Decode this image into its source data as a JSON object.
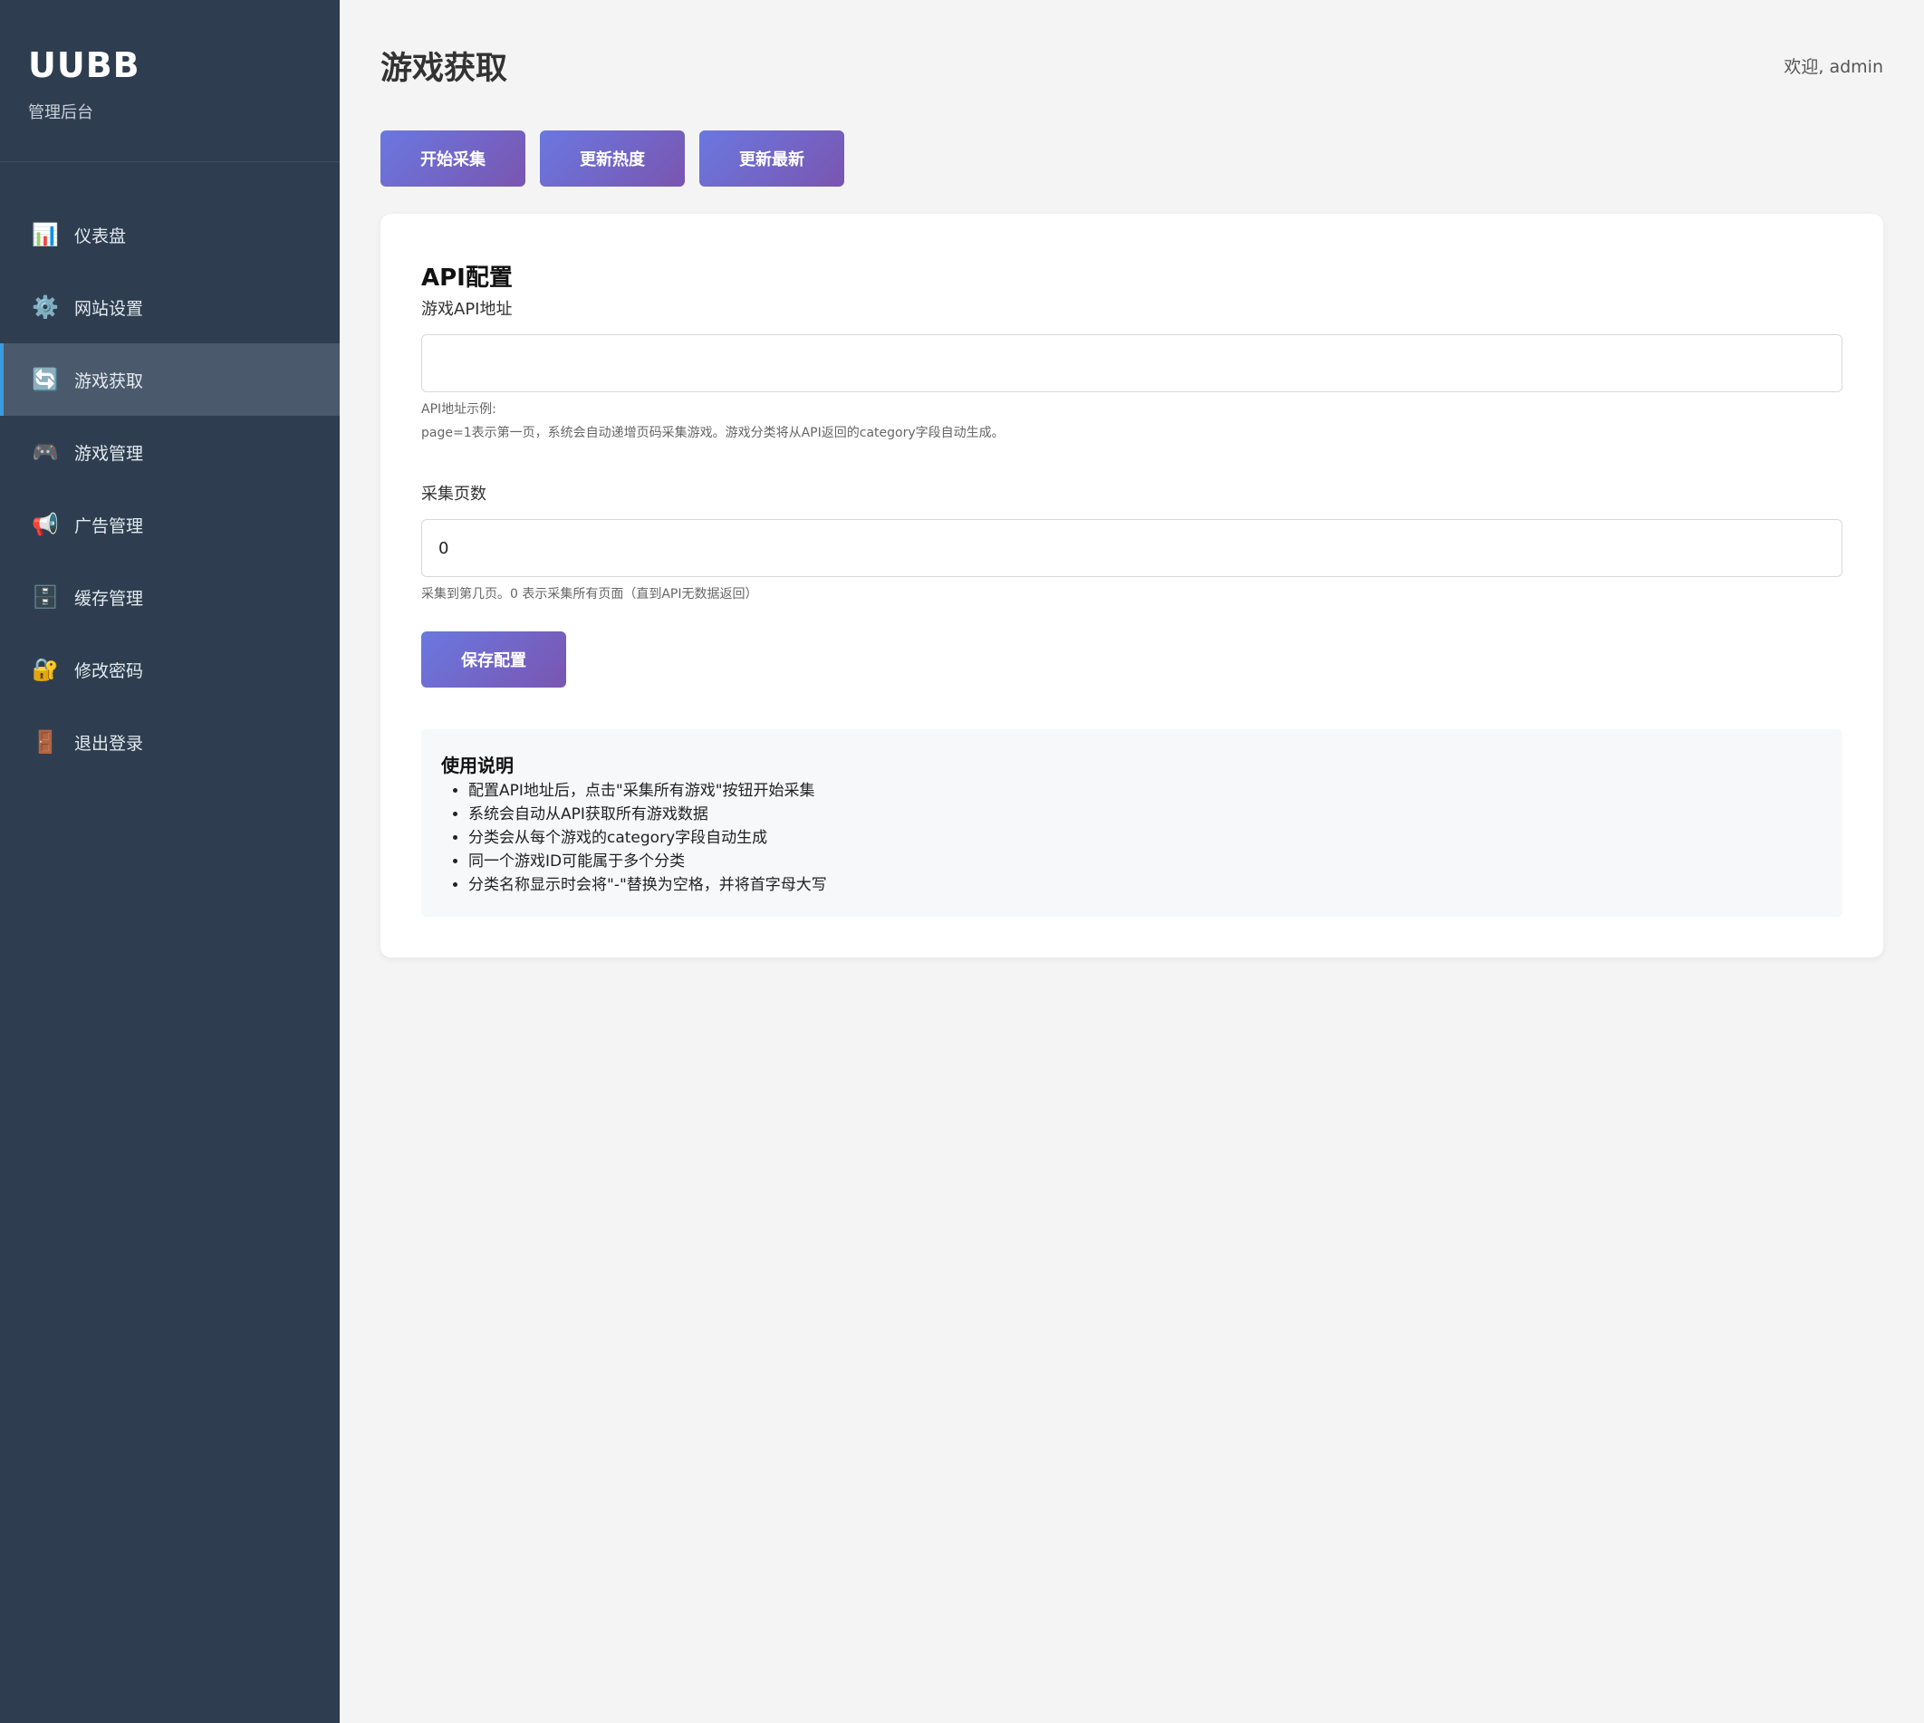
{
  "brand": {
    "title": "UUBB",
    "subtitle": "管理后台"
  },
  "nav": [
    {
      "label": "仪表盘",
      "icon": "📊"
    },
    {
      "label": "网站设置",
      "icon": "⚙️"
    },
    {
      "label": "游戏获取",
      "icon": "🔄",
      "active": true
    },
    {
      "label": "游戏管理",
      "icon": "🎮"
    },
    {
      "label": "广告管理",
      "icon": "📢"
    },
    {
      "label": "缓存管理",
      "icon": "🗄️"
    },
    {
      "label": "修改密码",
      "icon": "🔐"
    },
    {
      "label": "退出登录",
      "icon": "🚪"
    }
  ],
  "header": {
    "title": "游戏获取",
    "welcome": "欢迎, admin"
  },
  "actions": {
    "start": "开始采集",
    "update_hot": "更新热度",
    "update_new": "更新最新"
  },
  "config": {
    "title": "API配置",
    "api_label": "游戏API地址",
    "api_value": "",
    "api_hint_1": "API地址示例:",
    "api_hint_2": "page=1表示第一页，系统会自动递增页码采集游戏。游戏分类将从API返回的category字段自动生成。",
    "pages_label": "采集页数",
    "pages_value": "0",
    "pages_hint": "采集到第几页。0 表示采集所有页面（直到API无数据返回）",
    "save": "保存配置"
  },
  "help": {
    "title": "使用说明",
    "items": [
      "配置API地址后，点击\"采集所有游戏\"按钮开始采集",
      "系统会自动从API获取所有游戏数据",
      "分类会从每个游戏的category字段自动生成",
      "同一个游戏ID可能属于多个分类",
      "分类名称显示时会将\"-\"替换为空格，并将首字母大写"
    ]
  }
}
